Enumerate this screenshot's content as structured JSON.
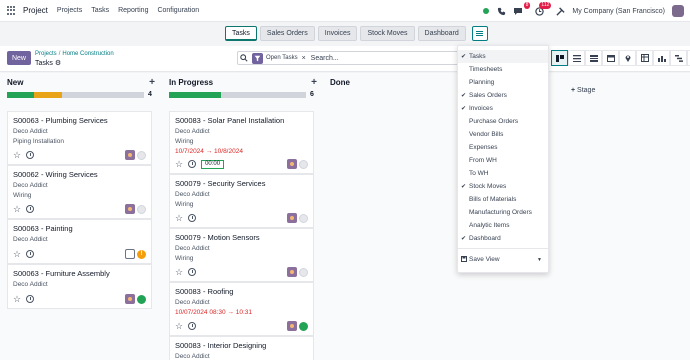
{
  "nav": {
    "app_name": "Project",
    "menu": [
      "Projects",
      "Tasks",
      "Reporting",
      "Configuration"
    ],
    "messages_badge": "8",
    "activities_badge": "112",
    "company": "My Company (San Francisco)"
  },
  "view_tabs": [
    {
      "label": "Tasks",
      "active": true
    },
    {
      "label": "Sales Orders",
      "active": false
    },
    {
      "label": "Invoices",
      "active": false
    },
    {
      "label": "Stock Moves",
      "active": false
    },
    {
      "label": "Dashboard",
      "active": false
    }
  ],
  "control": {
    "new_label": "New",
    "breadcrumb": [
      "Projects",
      "Home Construction"
    ],
    "title": "Tasks",
    "facet": "Open Tasks",
    "search_placeholder": "Search..."
  },
  "columns": [
    {
      "name": "New",
      "count": "4",
      "progress": {
        "green": 0.2,
        "orange": 0.2,
        "grey": 0.6
      }
    },
    {
      "name": "In Progress",
      "count": "6",
      "progress": {
        "green": 0.38,
        "orange": 0,
        "grey": 0.62
      }
    },
    {
      "name": "Done",
      "count": "",
      "progress": null
    }
  ],
  "add_stage_label": "Stage",
  "cards_new": [
    {
      "title": "S00063 - Plumbing Services",
      "customer": "Deco Addict",
      "tag": "Piping Installation",
      "status": "grey"
    },
    {
      "title": "S00062 - Wiring Services",
      "customer": "Deco Addict",
      "tag": "Wiring",
      "status": "grey"
    },
    {
      "title": "S00063 - Painting",
      "customer": "Deco Addict",
      "tag": "",
      "status": "warn"
    },
    {
      "title": "S00063 - Furniture Assembly",
      "customer": "Deco Addict",
      "tag": "",
      "status": "green"
    }
  ],
  "cards_progress": [
    {
      "title": "S00083 - Solar Panel Installation",
      "customer": "Deco Addict",
      "tag": "Wiring",
      "date": "10/7/2024 → 10/8/2024",
      "timer": "00:00",
      "status": "grey"
    },
    {
      "title": "S00079 - Security Services",
      "customer": "Deco Addict",
      "tag": "Wiring",
      "status": "grey"
    },
    {
      "title": "S00079 - Motion Sensors",
      "customer": "Deco Addict",
      "tag": "Wiring",
      "status": "grey"
    },
    {
      "title": "S00083 - Roofing",
      "customer": "Deco Addict",
      "date": "10/07/2024 08:30 → 10:31",
      "status": "green"
    },
    {
      "title": "S00083 - Interior Designing",
      "customer": "Deco Addict"
    }
  ],
  "dropdown": {
    "items": [
      {
        "label": "Tasks",
        "checked": true
      },
      {
        "label": "Timesheets",
        "checked": false
      },
      {
        "label": "Planning",
        "checked": false
      },
      {
        "label": "Sales Orders",
        "checked": true
      },
      {
        "label": "Invoices",
        "checked": true
      },
      {
        "label": "Purchase Orders",
        "checked": false
      },
      {
        "label": "Vendor Bills",
        "checked": false
      },
      {
        "label": "Expenses",
        "checked": false
      },
      {
        "label": "From WH",
        "checked": false
      },
      {
        "label": "To WH",
        "checked": false
      },
      {
        "label": "Stock Moves",
        "checked": true
      },
      {
        "label": "Bills of Materials",
        "checked": false
      },
      {
        "label": "Manufacturing Orders",
        "checked": false
      },
      {
        "label": "Analytic Items",
        "checked": false
      },
      {
        "label": "Dashboard",
        "checked": true
      }
    ],
    "save_view_label": "Save View"
  },
  "colors": {
    "accent": "#017e84",
    "brand": "#71639e",
    "green": "#22a355",
    "orange": "#e8a317"
  }
}
